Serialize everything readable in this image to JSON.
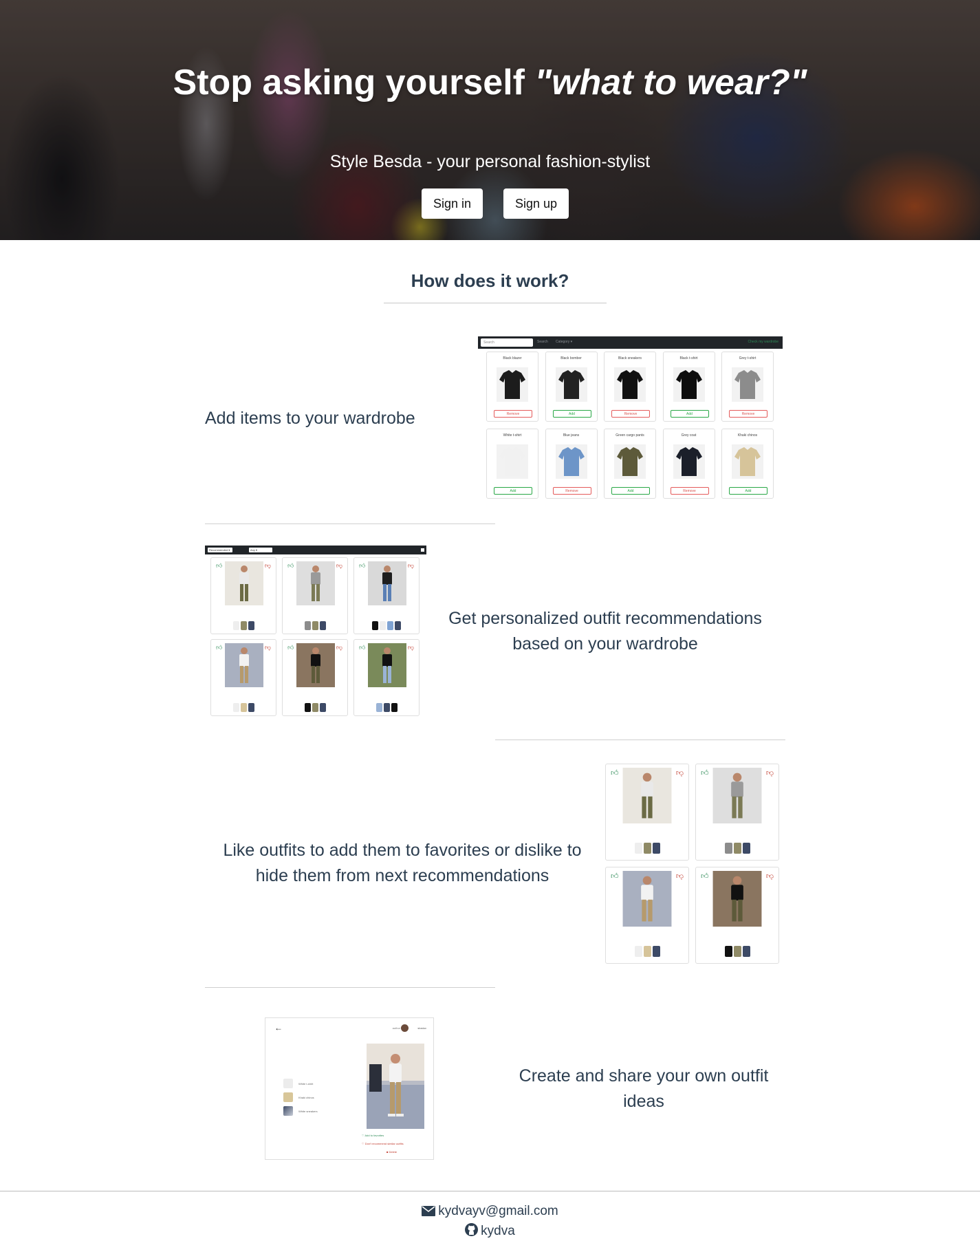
{
  "hero": {
    "title_main": "Stop asking yourself ",
    "title_emph": "\"what to wear?\"",
    "subtitle": "Style Besda - your personal fashion-stylist",
    "signin_label": "Sign in",
    "signup_label": "Sign up"
  },
  "how": {
    "title": "How does it work?",
    "steps": [
      {
        "text": "Add items to your wardrobe"
      },
      {
        "text": "Get personalized outfit recommendations based on your wardrobe"
      },
      {
        "text": "Like outfits to add them to favorites or dislike to hide them from next recommendations"
      },
      {
        "text": "Create and share your own outfit ideas"
      }
    ]
  },
  "wardrobe_shot": {
    "search_placeholder": "Search",
    "search_btn": "Search",
    "category": "Category ▾",
    "check_wardrobe": "Check my wardrobe",
    "items": [
      {
        "name": "Black blazer",
        "action": "Remove",
        "color": "#1c1c1c"
      },
      {
        "name": "Black bomber",
        "action": "Add",
        "color": "#222222"
      },
      {
        "name": "Black sneakers",
        "action": "Remove",
        "color": "#111111"
      },
      {
        "name": "Black t-shirt",
        "action": "Add",
        "color": "#0e0e0e"
      },
      {
        "name": "Grey t-shirt",
        "action": "Remove",
        "color": "#8c8c8c"
      },
      {
        "name": "White t-shirt",
        "action": "Add",
        "color": "#f1f1f1"
      },
      {
        "name": "Blue jeans",
        "action": "Remove",
        "color": "#6d95c8"
      },
      {
        "name": "Green cargo pants",
        "action": "Add",
        "color": "#5d5a3a"
      },
      {
        "name": "Grey coat",
        "action": "Remove",
        "color": "#1b1f2a"
      },
      {
        "name": "Khaki chinos",
        "action": "Add",
        "color": "#d6c49a"
      }
    ]
  },
  "reco_shot": {
    "select1": "Recommended ▾",
    "select2": "Any ▾"
  },
  "create_shot": {
    "author_label": "author",
    "author_name": "stostov",
    "items": [
      "White t-shirt",
      "Khaki chinos",
      "White sneakers"
    ],
    "add_favorites": "Add to favorites",
    "dont_recommend": "Don't recommend similar outfits",
    "delete": "Delete"
  },
  "footer": {
    "email": "kydvayv@gmail.com",
    "github": "kydva"
  },
  "colors": {
    "text": "#2c3e50",
    "like": "#2e8b57",
    "dislike": "#c0392b",
    "navbar": "#212529"
  }
}
